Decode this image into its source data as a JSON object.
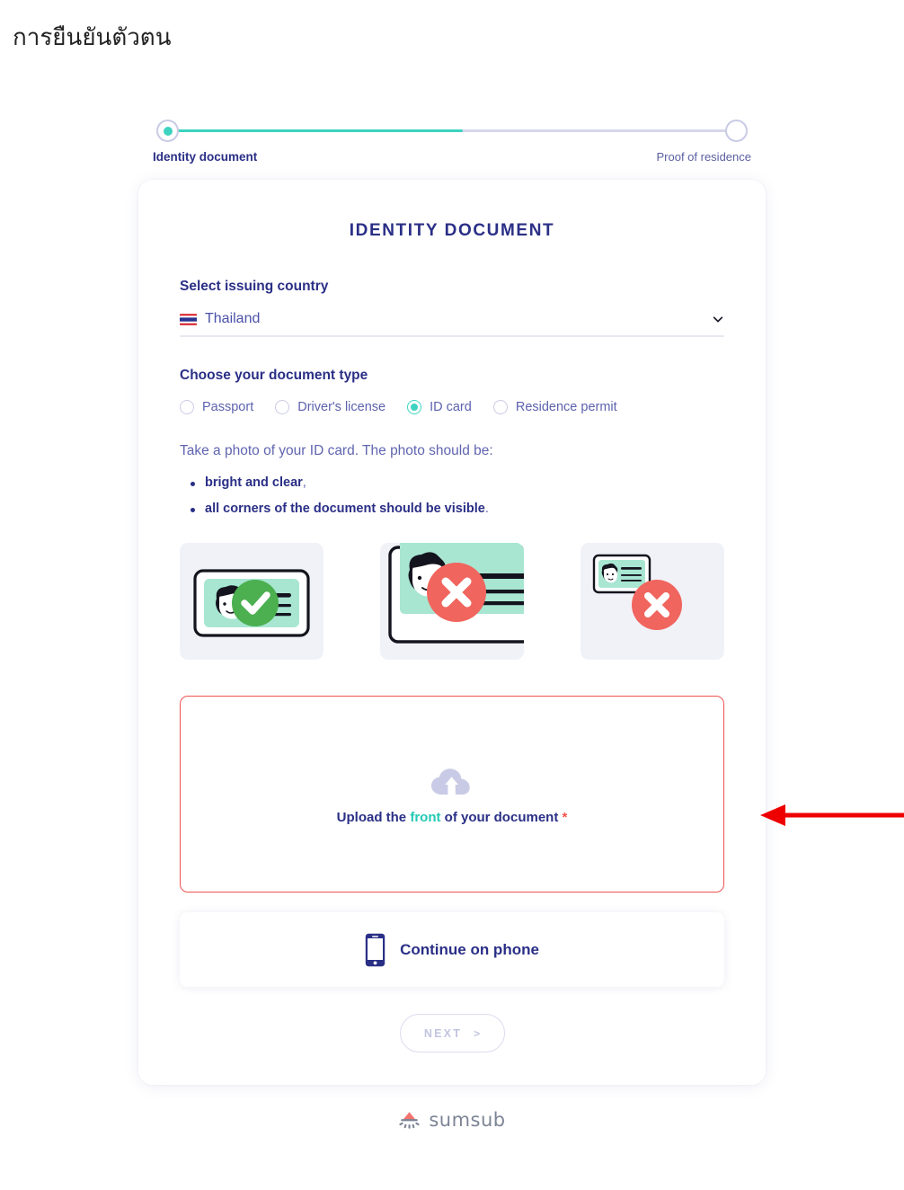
{
  "page": {
    "title": "การยืนยันตัวตน"
  },
  "stepper": {
    "steps": [
      {
        "label": "Identity document",
        "state": "active"
      },
      {
        "label": "Proof of residence",
        "state": "pending"
      }
    ],
    "progress_percent": 52,
    "active_color": "#3dd3c0",
    "track_color": "#d6d7ea"
  },
  "card": {
    "heading": "IDENTITY DOCUMENT",
    "country": {
      "label": "Select issuing country",
      "selected": "Thailand",
      "flag": "thailand-flag-icon",
      "chevron": "chevron-down-icon"
    },
    "doc_type": {
      "label": "Choose your document type",
      "options": [
        {
          "label": "Passport",
          "selected": false
        },
        {
          "label": "Driver's license",
          "selected": false
        },
        {
          "label": "ID card",
          "selected": true
        },
        {
          "label": "Residence permit",
          "selected": false
        }
      ]
    },
    "instructions": {
      "intro": "Take a photo of your ID card. The photo should be:",
      "bullets": [
        {
          "bold": "bright and clear",
          "tail": ","
        },
        {
          "bold": "all corners of the document should be visible",
          "tail": "."
        }
      ]
    },
    "examples": [
      {
        "name": "good-example-id-card",
        "status": "ok",
        "badge": "check-icon"
      },
      {
        "name": "bad-example-cropped-id-card",
        "status": "error",
        "badge": "cross-icon"
      },
      {
        "name": "bad-example-too-small-id-card",
        "status": "error",
        "badge": "cross-icon"
      }
    ],
    "upload": {
      "icon": "cloud-upload-icon",
      "text_before": "Upload the ",
      "accent_word": "front",
      "text_after": " of your document ",
      "required_mark": "*",
      "border_color": "#ef5350",
      "accent_color": "#23c9b4"
    },
    "phone": {
      "icon": "mobile-phone-icon",
      "label": "Continue on phone"
    },
    "next": {
      "label": "NEXT",
      "caret": ">",
      "disabled": true
    }
  },
  "footer": {
    "logo_mark": "sumsub-logo-icon",
    "logo_text": "sumsub"
  },
  "annotation": {
    "arrow": "red-left-arrow",
    "color": "#ee0000"
  }
}
